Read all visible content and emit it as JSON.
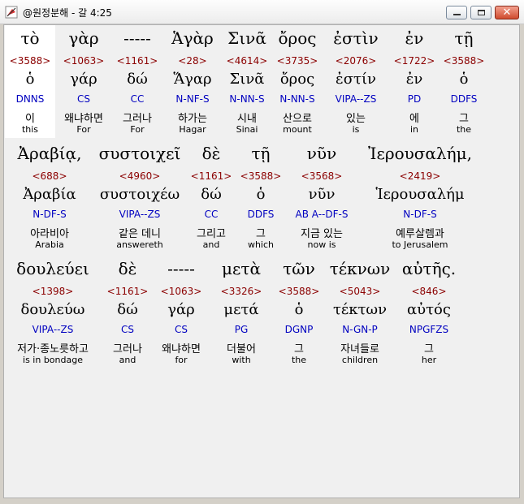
{
  "window": {
    "title": "@원정분해 - 갈 4:25",
    "close_glyph": "✕"
  },
  "rows": [
    [
      {
        "greek": "τὸ",
        "strong": "<3588>",
        "lemma": "ὁ",
        "parse": "DNNS",
        "korean": "이",
        "english": "this"
      },
      {
        "greek": "γὰρ",
        "strong": "<1063>",
        "lemma": "γάρ",
        "parse": "CS",
        "korean": "왜냐하면",
        "english": "For"
      },
      {
        "greek": "-----",
        "strong": "<1161>",
        "lemma": "δώ",
        "parse": "CC",
        "korean": "그러나",
        "english": "For"
      },
      {
        "greek": "Ἁγὰρ",
        "strong": "<28>",
        "lemma": "Ἅγαρ",
        "parse": "N-NF-S",
        "korean": "하가는",
        "english": "Hagar"
      },
      {
        "greek": "Σινᾶ",
        "strong": "<4614>",
        "lemma": "Σινᾶ",
        "parse": "N-NN-S",
        "korean": "시내",
        "english": "Sinai"
      },
      {
        "greek": "ὄρος",
        "strong": "<3735>",
        "lemma": "ὄρος",
        "parse": "N-NN-S",
        "korean": "산으로",
        "english": "mount"
      },
      {
        "greek": "ἐστὶν",
        "strong": "<2076>",
        "lemma": "ἐστίν",
        "parse": "VIPA--ZS",
        "korean": "있는",
        "english": "is"
      },
      {
        "greek": "ἐν",
        "strong": "<1722>",
        "lemma": "ἐν",
        "parse": "PD",
        "korean": "에",
        "english": "in"
      },
      {
        "greek": "τῇ",
        "strong": "<3588>",
        "lemma": "ὁ",
        "parse": "DDFS",
        "korean": "그",
        "english": "the"
      }
    ],
    [
      {
        "greek": "Ἀραβίᾳ,",
        "strong": "<688>",
        "lemma": "Ἀραβία",
        "parse": "N-DF-S",
        "korean": "아라비아",
        "english": "Arabia"
      },
      {
        "greek": "συστοιχεῖ",
        "strong": "<4960>",
        "lemma": "συστοιχέω",
        "parse": "VIPA--ZS",
        "korean": "같은 데니",
        "english": "answereth"
      },
      {
        "greek": "δὲ",
        "strong": "<1161>",
        "lemma": "δώ",
        "parse": "CC",
        "korean": "그리고",
        "english": "and"
      },
      {
        "greek": "τῇ",
        "strong": "<3588>",
        "lemma": "ὁ",
        "parse": "DDFS",
        "korean": "그",
        "english": "which"
      },
      {
        "greek": "νῦν",
        "strong": "<3568>",
        "lemma": "νῦν",
        "parse": "AB A--DF-S",
        "korean": "지금 있는",
        "english": "now is"
      },
      {
        "greek": "Ἰερουσαλήμ,",
        "strong": "<2419>",
        "lemma": "Ἱερουσαλήμ",
        "parse": "N-DF-S",
        "korean": "예루살렘과",
        "english": "to Jerusalem"
      }
    ],
    [
      {
        "greek": "δουλεύει",
        "strong": "<1398>",
        "lemma": "δουλεύω",
        "parse": "VIPA--ZS",
        "korean": "저가·종노릇하고",
        "english": "is in bondage"
      },
      {
        "greek": "δὲ",
        "strong": "<1161>",
        "lemma": "δώ",
        "parse": "CS",
        "korean": "그러나",
        "english": "and"
      },
      {
        "greek": "-----",
        "strong": "<1063>",
        "lemma": "γάρ",
        "parse": "CS",
        "korean": "왜냐하면",
        "english": "for"
      },
      {
        "greek": "μετὰ",
        "strong": "<3326>",
        "lemma": "μετά",
        "parse": "PG",
        "korean": "더불어",
        "english": "with"
      },
      {
        "greek": "τῶν",
        "strong": "<3588>",
        "lemma": "ὁ",
        "parse": "DGNP",
        "korean": "그",
        "english": "the"
      },
      {
        "greek": "τέκνων",
        "strong": "<5043>",
        "lemma": "τέκτων",
        "parse": "N-GN-P",
        "korean": "자녀들로",
        "english": "children"
      },
      {
        "greek": "αὐτῆς.",
        "strong": "<846>",
        "lemma": "αὐτός",
        "parse": "NPGFZS",
        "korean": "그",
        "english": "her"
      }
    ]
  ]
}
